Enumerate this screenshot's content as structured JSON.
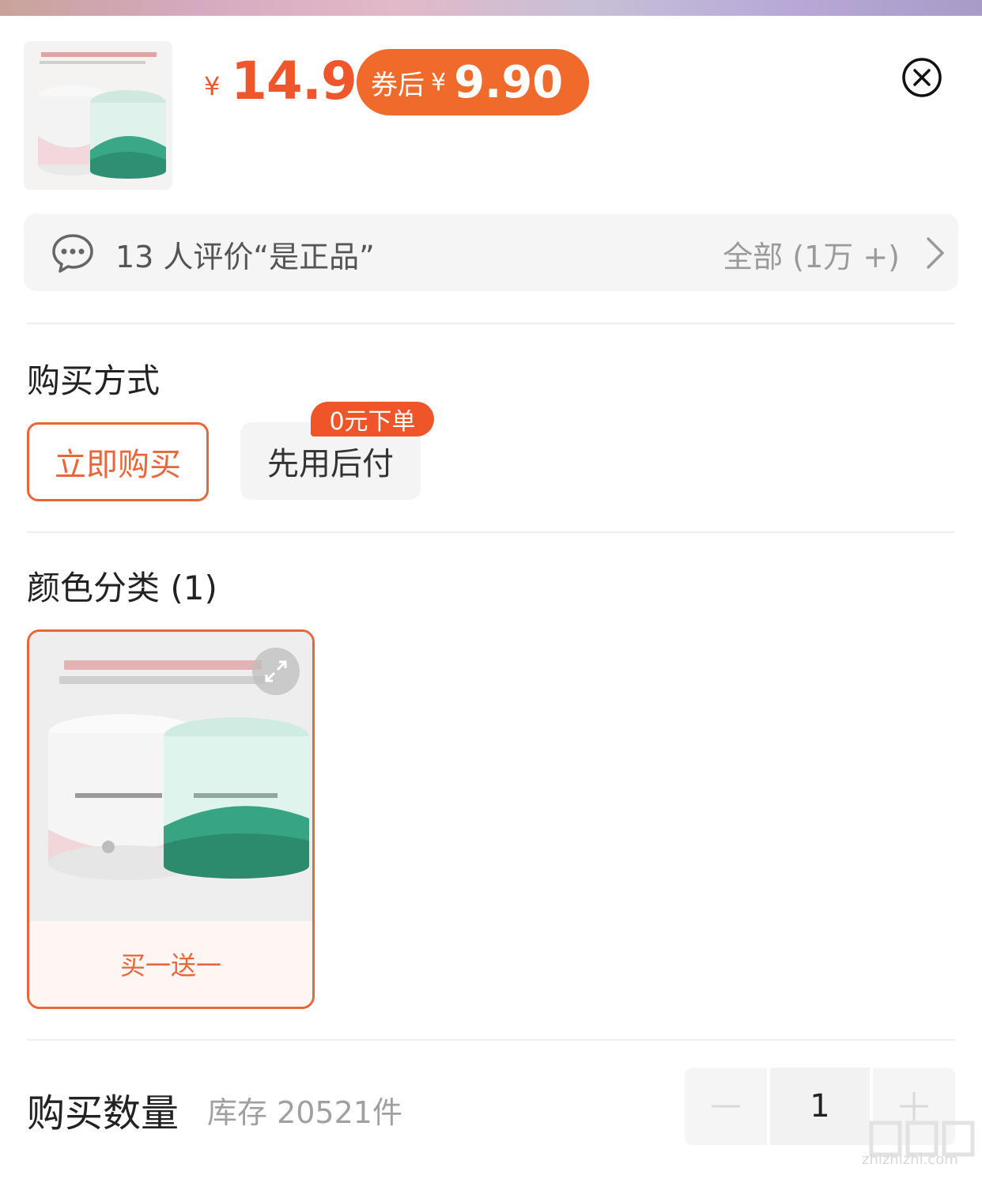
{
  "header": {
    "currency_symbol": "¥",
    "price": "14.9",
    "coupon_prefix": "券后",
    "coupon_currency_symbol": "¥",
    "coupon_price": "9.90",
    "close_icon": "close-circle-icon",
    "thumbnail_icon": "product-thumbnail"
  },
  "review": {
    "text": "13 人评价“是正品”",
    "all_label": "全部 (1万 +)",
    "icon": "chat-bubble-icon"
  },
  "purchase_method": {
    "title": "购买方式",
    "options": [
      {
        "label": "立即购买",
        "selected": true
      },
      {
        "label": "先用后付",
        "selected": false,
        "badge": "0元下单"
      }
    ]
  },
  "color_category": {
    "title": "颜色分类 (1)",
    "items": [
      {
        "label": "买一送一",
        "selected": true
      }
    ]
  },
  "quantity": {
    "title": "购买数量",
    "stock_text": "库存 20521件",
    "value": "1"
  },
  "watermark": {
    "text": "zhizhizhi.com"
  },
  "colors": {
    "accent": "#f0562b",
    "coupon_pill": "#f06a2c"
  }
}
